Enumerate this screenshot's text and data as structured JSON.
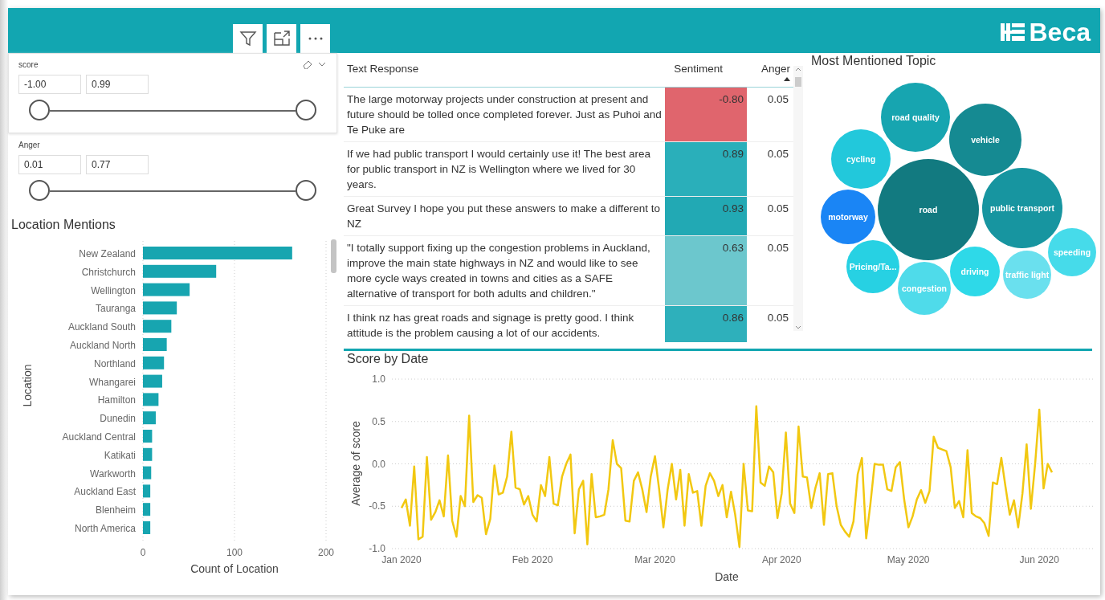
{
  "header": {
    "buttons": [
      {
        "kind": "filter"
      },
      {
        "kind": "focus"
      },
      {
        "kind": "more"
      }
    ],
    "logo": "Beca"
  },
  "slicers": [
    {
      "title": "score",
      "focused": true,
      "min": "-1.00",
      "max": "0.99",
      "thumbs": [
        {
          "level": 0
        },
        {
          "level": 1
        }
      ]
    },
    {
      "title": "Anger",
      "focused": false,
      "min": "0.01",
      "max": "0.77",
      "thumbs": [
        {
          "level": 0
        },
        {
          "level": 1
        }
      ]
    }
  ],
  "location_chart": {
    "title": "Location Mentions",
    "chart_data": {
      "type": "bar",
      "orientation": "horizontal",
      "xlabel": "Count of Location",
      "ylabel": "Location",
      "xlim": [
        0,
        200
      ],
      "xticks": [
        0,
        100,
        200
      ],
      "grid": true,
      "categories": [
        "New Zealand",
        "Christchurch",
        "Wellington",
        "Tauranga",
        "Auckland South",
        "Auckland North",
        "Northland",
        "Whangarei",
        "Hamilton",
        "Dunedin",
        "Auckland Central",
        "Katikati",
        "Warkworth",
        "Auckland East",
        "Blenheim",
        "North America"
      ],
      "series": [
        {
          "color": "#17a5b0",
          "values": [
            163,
            80,
            51,
            37,
            31,
            26,
            23,
            21,
            17,
            14,
            10,
            10,
            9,
            8,
            8,
            8
          ]
        }
      ]
    }
  },
  "table": {
    "columns": [
      {
        "label": "Text Response",
        "sorted": false
      },
      {
        "label": "Sentiment",
        "sorted": false
      },
      {
        "label": "Anger",
        "sorted": true
      }
    ],
    "rows": [
      {
        "text": "The large motorway projects under construction at present and future should be tolled once completed forever. Just as Puhoi and Te Puke are",
        "sentiment": "-0.80",
        "color": "#e0656d",
        "anger": "0.05"
      },
      {
        "text": "If we had public transport I would certainly use it! The best area for public transport in NZ is Wellington where we lived for 30 years.",
        "sentiment": "0.89",
        "color": "#2aafba",
        "anger": "0.05"
      },
      {
        "text": "Great Survey I hope you put these answers to make a different to NZ",
        "sentiment": "0.93",
        "color": "#22a9b4",
        "anger": "0.05"
      },
      {
        "text": "\"I totally support fixing up the congestion problems in Auckland, improve the main state highways in NZ and would like to see more cycle ways created in towns and cities as a SAFE alternative of transport for both adults and children.\"",
        "sentiment": "0.63",
        "color": "#6cc7cd",
        "anger": "0.05"
      },
      {
        "text": "I think nz has great roads and signage is pretty good. I think attitude is the problem causing a lot of our accidents.",
        "sentiment": "0.86",
        "color": "#2eb0bb",
        "anger": "0.05"
      }
    ]
  },
  "topics": {
    "title": "Most Mentioned Topic",
    "bubbles": [
      {
        "label": "road quality",
        "color": "#17a5b0"
      },
      {
        "label": "vehicle",
        "color": "#158a92"
      },
      {
        "label": "cycling",
        "color": "#22c8db"
      },
      {
        "label": "road",
        "color": "#127a80"
      },
      {
        "label": "public transport",
        "color": "#1795a0"
      },
      {
        "label": "motorway",
        "color": "#1a85f5"
      },
      {
        "label": "speeding",
        "color": "#46dbea"
      },
      {
        "label": "Pricing/Ta...",
        "color": "#27d1e3"
      },
      {
        "label": "driving",
        "color": "#2ed9e8"
      },
      {
        "label": "traffic light",
        "color": "#6ae0ee"
      },
      {
        "label": "congestion",
        "color": "#4fdbea"
      }
    ]
  },
  "score_chart": {
    "title": "Score by Date",
    "chart_data": {
      "type": "line",
      "xlabel": "Date",
      "ylabel": "Average of score",
      "ylim": [
        -1,
        1
      ],
      "grid": true,
      "categories": [
        "Jan 2020",
        null,
        null,
        null,
        null,
        null,
        null,
        null,
        null,
        null,
        null,
        null,
        null,
        null,
        null,
        null,
        null,
        null,
        null,
        null,
        null,
        null,
        null,
        null,
        null,
        null,
        null,
        null,
        null,
        null,
        null,
        "Feb 2020",
        null,
        null,
        null,
        null,
        null,
        null,
        null,
        null,
        null,
        null,
        null,
        null,
        null,
        null,
        null,
        null,
        null,
        null,
        null,
        null,
        null,
        null,
        null,
        null,
        null,
        null,
        null,
        null,
        "Mar 2020",
        null,
        null,
        null,
        null,
        null,
        null,
        null,
        null,
        null,
        null,
        null,
        null,
        null,
        null,
        null,
        null,
        null,
        null,
        null,
        null,
        null,
        null,
        null,
        null,
        null,
        null,
        null,
        null,
        null,
        "Apr 2020",
        null,
        null,
        null,
        null,
        null,
        null,
        null,
        null,
        null,
        null,
        null,
        null,
        null,
        null,
        null,
        null,
        null,
        null,
        null,
        null,
        null,
        null,
        null,
        null,
        null,
        null,
        null,
        null,
        null,
        "May 2020",
        null,
        null,
        null,
        null,
        null,
        null,
        null,
        null,
        null,
        null,
        null,
        null,
        null,
        null,
        null,
        null,
        null,
        null,
        null,
        null,
        null,
        null,
        null,
        null,
        null,
        null,
        null,
        null,
        null,
        null,
        "Jun 2020",
        null,
        null,
        null
      ],
      "yticks": [
        {
          "value": 1,
          "label": "1.0"
        },
        {
          "value": 0.5,
          "label": "0.5"
        },
        {
          "value": 0,
          "label": "0.0"
        },
        {
          "value": -0.5,
          "label": "-0.5"
        },
        {
          "value": -1,
          "label": "-1.0"
        }
      ],
      "series": [
        {
          "color": "#f2c811",
          "values": [
            -0.52,
            -0.42,
            -0.73,
            -0.03,
            -0.89,
            -0.86,
            0.08,
            -0.66,
            -0.57,
            -0.43,
            -0.62,
            0.1,
            -0.67,
            -0.86,
            -0.38,
            -0.5,
            0.57,
            -0.45,
            -0.37,
            -0.4,
            -0.83,
            -0.65,
            -0.02,
            -0.36,
            -0.34,
            -0.15,
            0.38,
            -0.28,
            -0.3,
            -0.48,
            -0.38,
            -0.6,
            -0.68,
            -0.25,
            -0.38,
            0.08,
            -0.47,
            -0.49,
            -0.15,
            0.0,
            0.11,
            -0.82,
            -0.3,
            -0.2,
            -0.95,
            -0.12,
            -0.63,
            -0.62,
            -0.6,
            -0.3,
            0.28,
            0.0,
            -0.05,
            -0.67,
            -0.68,
            -0.2,
            -0.1,
            -0.3,
            -0.57,
            -0.15,
            0.09,
            -0.3,
            -0.75,
            -0.3,
            0.0,
            -0.42,
            -0.07,
            -0.73,
            -0.12,
            -0.34,
            -0.32,
            -0.73,
            -0.26,
            -0.11,
            -0.2,
            -0.38,
            -0.25,
            -0.63,
            -0.33,
            -0.6,
            -0.98,
            0.0,
            -0.55,
            -0.56,
            0.68,
            -0.22,
            -0.26,
            -0.03,
            -0.1,
            -0.64,
            -0.35,
            0.37,
            -0.47,
            -0.58,
            0.44,
            -0.15,
            -0.16,
            -0.52,
            -0.28,
            -0.11,
            -0.72,
            -0.12,
            -0.11,
            -0.5,
            -0.72,
            -0.8,
            -0.86,
            -0.68,
            -0.12,
            0.07,
            -0.88,
            -0.48,
            0.0,
            -0.01,
            -0.01,
            -0.3,
            -0.32,
            -0.04,
            0.02,
            -0.42,
            -0.75,
            -0.62,
            -0.42,
            -0.31,
            -0.46,
            -0.32,
            0.32,
            0.19,
            0.17,
            0.15,
            -0.04,
            -0.52,
            -0.44,
            -0.63,
            0.16,
            -0.58,
            -0.62,
            -0.64,
            -0.7,
            -0.85,
            -0.22,
            -0.24,
            0.07,
            -0.27,
            -0.6,
            -0.43,
            -0.75,
            -0.35,
            0.23,
            -0.53,
            0.0,
            0.64,
            -0.29,
            0.0,
            -0.1
          ]
        }
      ]
    }
  }
}
